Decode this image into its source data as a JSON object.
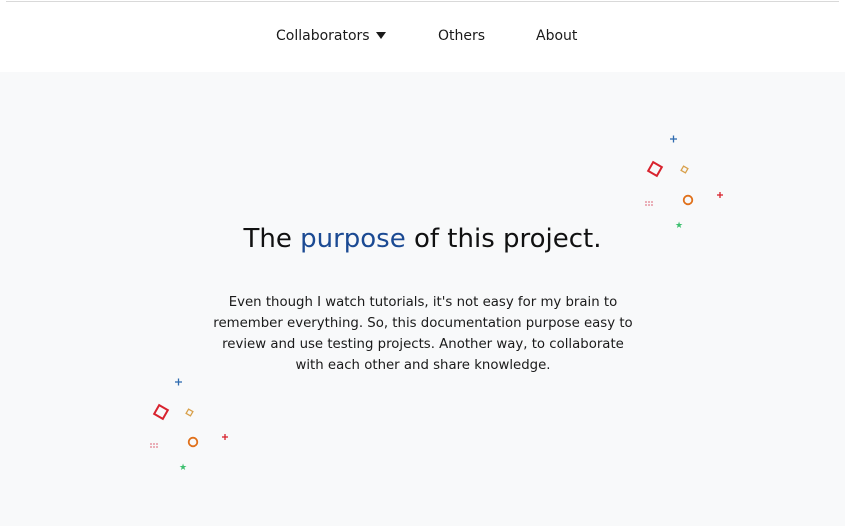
{
  "nav": {
    "items": [
      {
        "label": "Collaborators",
        "has_dropdown": true
      },
      {
        "label": "Others"
      },
      {
        "label": "About"
      }
    ]
  },
  "hero": {
    "title_before": "The ",
    "title_accent": "purpose",
    "title_after": " of this project.",
    "description": "Even though I watch tutorials, it's not easy for my brain to remember everything. So, this documentation purpose easy to review and use testing projects. Another way, to collaborate with each other and share knowledge."
  },
  "colors": {
    "accent": "#1b4a93",
    "hero_background": "#f8f9fa",
    "decor_red": "#d8232e",
    "decor_orange": "#e0701a",
    "decor_yellow": "#d8a04a",
    "decor_blue": "#2f6bb0",
    "decor_green": "#3cbf6e"
  },
  "icons": [
    "caret-down-icon",
    "confetti-decoration"
  ]
}
